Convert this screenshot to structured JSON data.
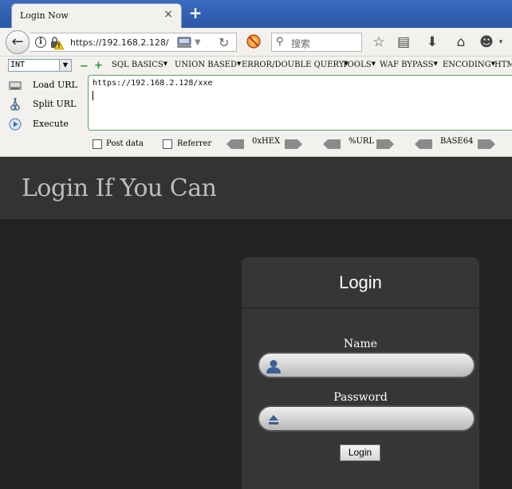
{
  "browser": {
    "tab_title": "Login Now",
    "tab_close": "×",
    "new_tab": "+",
    "url_host": "https://192.168.2.128/",
    "search_placeholder": "搜索"
  },
  "hackbar": {
    "select_value": "INT",
    "minus": "−",
    "plus": "+",
    "menus": [
      "SQL BASICS",
      "UNION BASED",
      "ERROR/DOUBLE QUERY",
      "TOOLS",
      "WAF BYPASS",
      "ENCODING",
      "HTML"
    ],
    "actions": [
      "Load URL",
      "Split URL",
      "Execute"
    ],
    "url_value": "https://192.168.2.128/xxe",
    "post_data_label": "Post data",
    "referrer_label": "Referrer",
    "encoders": [
      "0xHEX",
      "%URL",
      "BASE64"
    ]
  },
  "page": {
    "title": "Login If You Can",
    "card_title": "Login",
    "name_label": "Name",
    "password_label": "Password",
    "login_button": "Login"
  }
}
